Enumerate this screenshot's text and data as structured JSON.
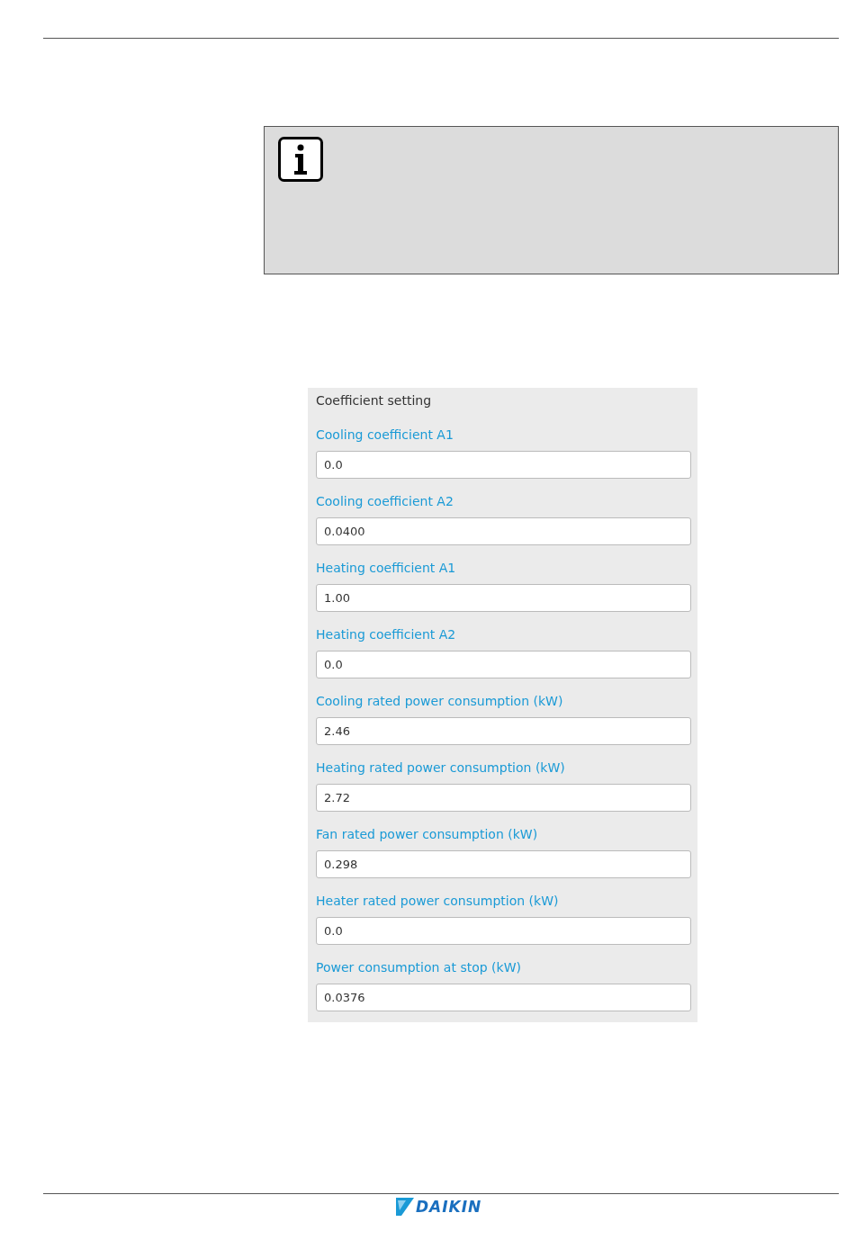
{
  "panel": {
    "title": "Coefficient setting",
    "fields": [
      {
        "label": "Cooling coefficient A1",
        "value": "0.0"
      },
      {
        "label": "Cooling coefficient A2",
        "value": "0.0400"
      },
      {
        "label": "Heating coefficient A1",
        "value": "1.00"
      },
      {
        "label": "Heating coefficient A2",
        "value": "0.0"
      },
      {
        "label": "Cooling rated power consumption (kW)",
        "value": "2.46"
      },
      {
        "label": "Heating rated power consumption (kW)",
        "value": "2.72"
      },
      {
        "label": "Fan rated power consumption (kW)",
        "value": "0.298"
      },
      {
        "label": "Heater rated power consumption (kW)",
        "value": "0.0"
      },
      {
        "label": "Power consumption at stop (kW)",
        "value": "0.0376"
      }
    ]
  },
  "footer": {
    "logo": "DAIKIN"
  }
}
